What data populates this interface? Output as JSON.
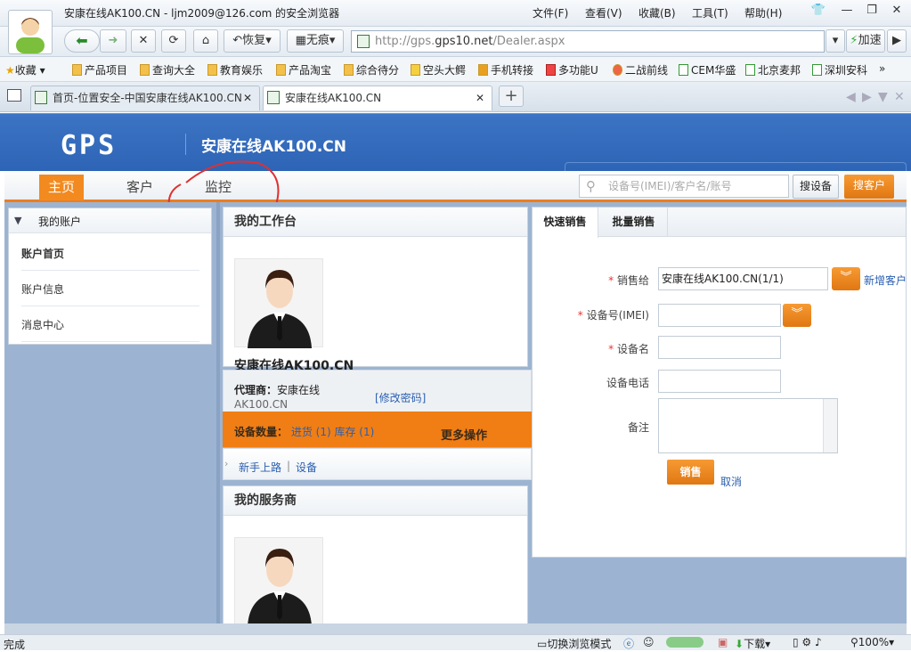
{
  "window": {
    "title": "安康在线AK100.CN - ljm2009@126.com 的安全浏览器",
    "menus": [
      "文件(F)",
      "查看(V)",
      "收藏(B)",
      "工具(T)",
      "帮助(H)"
    ]
  },
  "nav": {
    "back_label": "",
    "restore_label": "恢复",
    "notrace_label": "无痕",
    "url_prefix": "http://gps.",
    "url_host": "gps10.net",
    "url_path": "/Dealer.aspx",
    "speed_label": "加速"
  },
  "favorites": {
    "label": "收藏",
    "items": [
      "产品项目",
      "查询大全",
      "教育娱乐",
      "产品淘宝",
      "综合待分",
      "空头大鳄",
      "手机转接",
      "多功能U",
      "二战前线",
      "CEM华盛",
      "北京麦邦",
      "深圳安科"
    ]
  },
  "tabs": [
    {
      "label": "首页-位置安全-中国安康在线AK100.CN"
    },
    {
      "label": "安康在线AK100.CN"
    }
  ],
  "site": {
    "logo": "GPS",
    "title": "安康在线AK100.CN"
  },
  "mainnav": {
    "items": [
      "主页",
      "客户",
      "监控"
    ],
    "search_placeholder": "设备号(IMEI)/客户名/账号",
    "search_device": "搜设备",
    "search_customer": "搜客户"
  },
  "sidebar": {
    "header": "我的账户",
    "items": [
      "账户首页",
      "账户信息",
      "消息中心"
    ]
  },
  "workbench": {
    "title": "我的工作台",
    "name": "安康在线AK100.CN",
    "agent_label": "代理商：",
    "agent_value": "安康在线",
    "agent_value2": "AK100.CN",
    "change_pwd": "[修改密码]",
    "device_count_label": "设备数量：",
    "device_links": "进货 (1) 库存 (1)",
    "more_ops": "更多操作",
    "guide": "新手上路",
    "device": "设备"
  },
  "services": {
    "title": "我的服务商"
  },
  "sales": {
    "tabs": [
      "快速销售",
      "批量销售"
    ],
    "sell_to_label": "销售给",
    "sell_to_value": "安康在线AK100.CN(1/1)",
    "new_customer": "新增客户",
    "imei_label": "设备号(IMEI)",
    "name_label": "设备名",
    "phone_label": "设备电话",
    "remark_label": "备注",
    "submit": "销售",
    "cancel": "取消"
  },
  "status": {
    "left": "完成",
    "mode": "切换浏览模式",
    "download": "下载",
    "zoom": "100%"
  },
  "colors": {
    "accent": "#f28a20",
    "header": "#3269b8"
  }
}
